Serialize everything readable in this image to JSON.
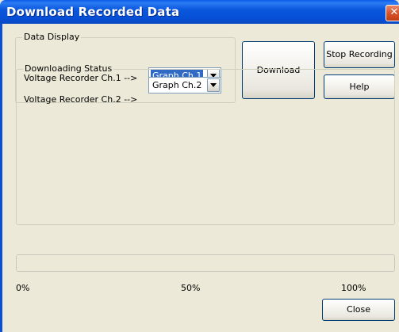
{
  "window": {
    "title": "Download Recorded Data",
    "close_glyph": "✕"
  },
  "data_display": {
    "group_label": "Data Display",
    "rows": [
      {
        "label": "Voltage Recorder Ch.1 -->",
        "selected": "Graph Ch.1"
      },
      {
        "label": "Voltage Recorder Ch.2 -->",
        "selected": "Graph Ch.2"
      }
    ]
  },
  "buttons": {
    "download": "Download",
    "stop_recording": "Stop Recording",
    "help": "Help",
    "close": "Close"
  },
  "status": {
    "group_label": "Downloading Status"
  },
  "progress": {
    "value_percent": 0,
    "tick_labels": [
      "0%",
      "50%",
      "100%"
    ]
  },
  "icons": {
    "dropdown": "chevron-down-icon",
    "close": "close-icon"
  },
  "colors": {
    "titlebar": "#0a58dd",
    "selection": "#316ac5",
    "face": "#ece9d8"
  }
}
